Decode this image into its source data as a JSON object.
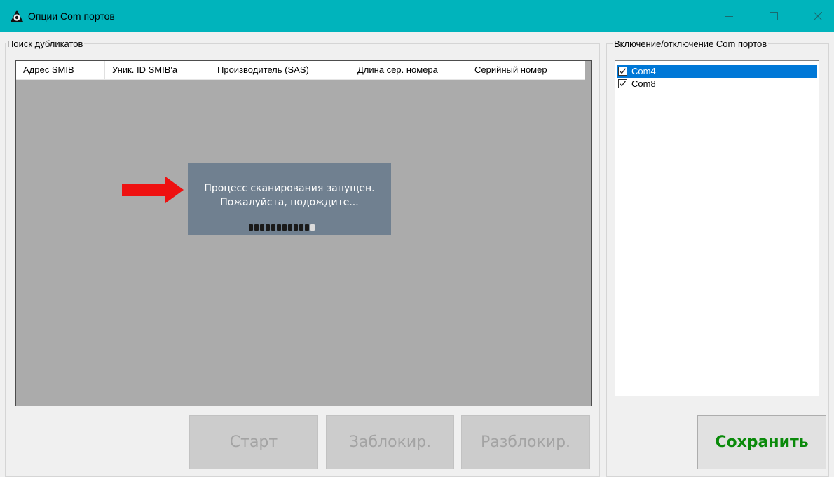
{
  "window": {
    "title": "Опции Com портов",
    "title_bar_color": "#00b4bc",
    "controls": [
      "minimize-icon",
      "maximize-icon",
      "close-icon"
    ]
  },
  "duplicates": {
    "group_label": "Поиск дубликатов",
    "columns": [
      "Адрес SMIB",
      "Уник. ID SMIB'а",
      "Производитель (SAS)",
      "Длина сер. номера",
      "Серийный номер"
    ],
    "rows": [],
    "overlay": {
      "line1": "Процесс сканирования запущен.",
      "line2": "Пожалуйста, подождите...",
      "progress": 0.92
    },
    "buttons": {
      "start": "Старт",
      "block": "Заблокир.",
      "unblock": "Разблокир."
    }
  },
  "ports": {
    "group_label": "Включение/отключение Com портов",
    "items": [
      {
        "label": "Com4",
        "checked": true,
        "selected": true
      },
      {
        "label": "Com8",
        "checked": true,
        "selected": false
      }
    ],
    "save_label": "Сохранить",
    "save_color": "#0a8a0a"
  },
  "annotation": {
    "arrow_color": "#ee1111"
  }
}
